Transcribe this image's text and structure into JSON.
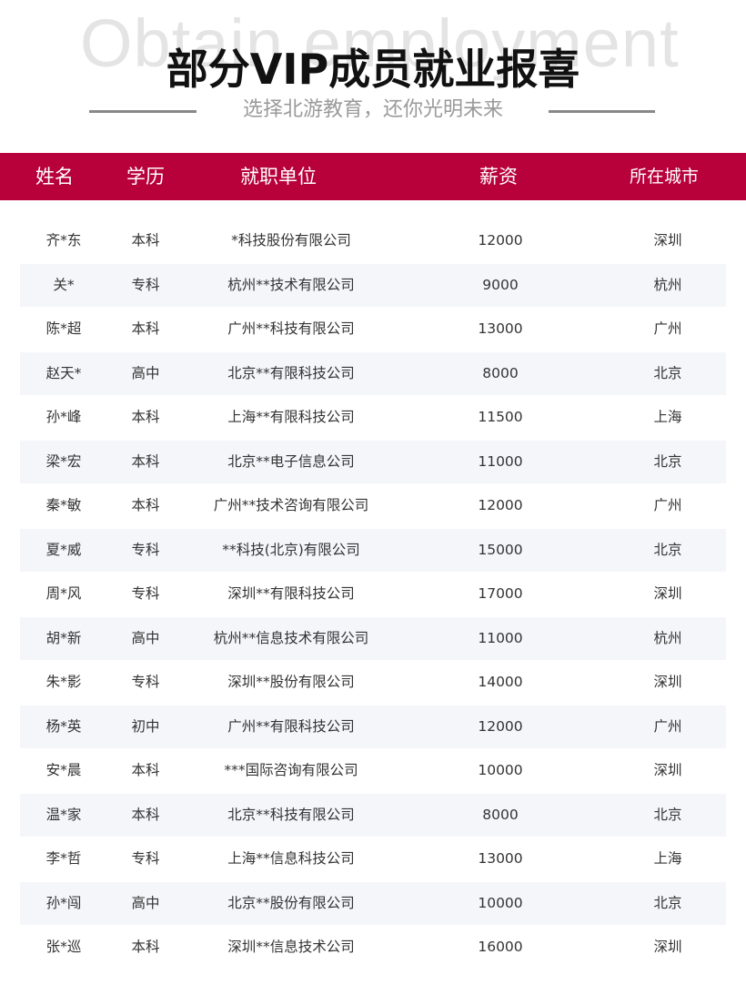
{
  "header": {
    "background_text": "Obtain employment",
    "title": "部分VIP成员就业报喜",
    "subtitle": "选择北游教育，还你光明未来"
  },
  "colors": {
    "header_bar": "#b8003a",
    "alt_row": "#f5f6fa",
    "title": "#111111",
    "subtitle": "#9a9a9a"
  },
  "table": {
    "headers": {
      "name": "姓名",
      "education": "学历",
      "company": "就职单位",
      "salary": "薪资",
      "city": "所在城市"
    },
    "rows": [
      {
        "name": "齐*东",
        "education": "本科",
        "company": "*科技股份有限公司",
        "salary": "12000",
        "city": "深圳"
      },
      {
        "name": "关*",
        "education": "专科",
        "company": "杭州**技术有限公司",
        "salary": "9000",
        "city": "杭州"
      },
      {
        "name": "陈*超",
        "education": "本科",
        "company": "广州**科技有限公司",
        "salary": "13000",
        "city": "广州"
      },
      {
        "name": "赵天*",
        "education": "高中",
        "company": "北京**有限科技公司",
        "salary": "8000",
        "city": "北京"
      },
      {
        "name": "孙*峰",
        "education": "本科",
        "company": "上海**有限科技公司",
        "salary": "11500",
        "city": "上海"
      },
      {
        "name": "梁*宏",
        "education": "本科",
        "company": "北京**电子信息公司",
        "salary": "11000",
        "city": "北京"
      },
      {
        "name": "秦*敏",
        "education": "本科",
        "company": "广州**技术咨询有限公司",
        "salary": "12000",
        "city": "广州"
      },
      {
        "name": "夏*威",
        "education": "专科",
        "company": "**科技(北京)有限公司",
        "salary": "15000",
        "city": "北京"
      },
      {
        "name": "周*风",
        "education": "专科",
        "company": "深圳**有限科技公司",
        "salary": "17000",
        "city": "深圳"
      },
      {
        "name": "胡*新",
        "education": "高中",
        "company": "杭州**信息技术有限公司",
        "salary": "11000",
        "city": "杭州"
      },
      {
        "name": "朱*影",
        "education": "专科",
        "company": "深圳**股份有限公司",
        "salary": "14000",
        "city": "深圳"
      },
      {
        "name": "杨*英",
        "education": "初中",
        "company": "广州**有限科技公司",
        "salary": "12000",
        "city": "广州"
      },
      {
        "name": "安*晨",
        "education": "本科",
        "company": "***国际咨询有限公司",
        "salary": "10000",
        "city": "深圳"
      },
      {
        "name": "温*家",
        "education": "本科",
        "company": "北京**科技有限公司",
        "salary": "8000",
        "city": "北京"
      },
      {
        "name": "李*哲",
        "education": "专科",
        "company": "上海**信息科技公司",
        "salary": "13000",
        "city": "上海"
      },
      {
        "name": "孙*闯",
        "education": "高中",
        "company": "北京**股份有限公司",
        "salary": "10000",
        "city": "北京"
      },
      {
        "name": "张*巡",
        "education": "本科",
        "company": "深圳**信息技术公司",
        "salary": "16000",
        "city": "深圳"
      }
    ]
  }
}
